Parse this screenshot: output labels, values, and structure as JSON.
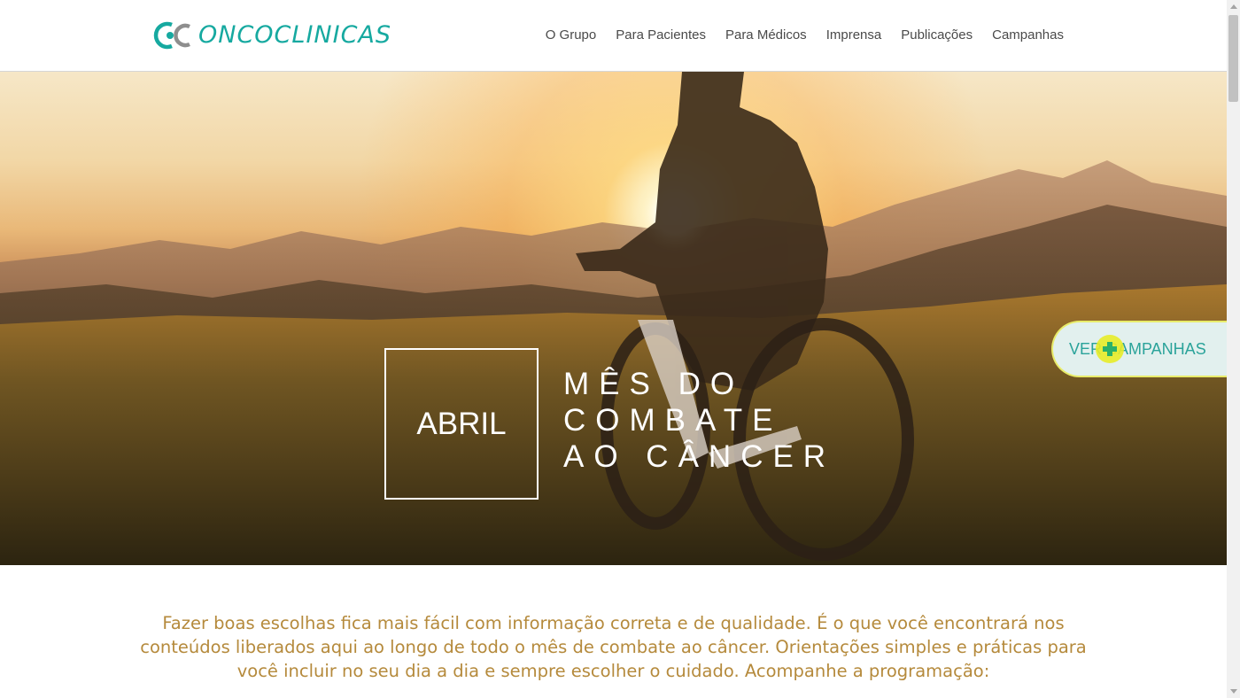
{
  "header": {
    "logo_text": "ONCOCLINICAS",
    "nav": [
      "O Grupo",
      "Para Pacientes",
      "Para Médicos",
      "Imprensa",
      "Publicações",
      "Campanhas"
    ]
  },
  "hero": {
    "box_label": "ABRIL",
    "title_lines": [
      "MÊS DO",
      "COMBATE",
      "AO CÂNCER"
    ]
  },
  "floating_button": {
    "label": "VER CAMPANHAS"
  },
  "intro": {
    "text": "Fazer boas escolhas fica mais fácil com informação correta e de qualidade. É o que você encontrará nos conteúdos liberados aqui ao longo de todo o mês de combate ao câncer. Orientações simples e práticas para você incluir no seu dia a dia e sempre escolher o cuidado. Acompanhe a programação:"
  },
  "colors": {
    "brand_teal": "#16a9a0",
    "intro_text": "#b58a3c",
    "button_bg": "#e2f0ee",
    "button_border": "#e8ec6a"
  },
  "icons": [
    "oncoclinicas-logo-icon",
    "plus-icon"
  ]
}
